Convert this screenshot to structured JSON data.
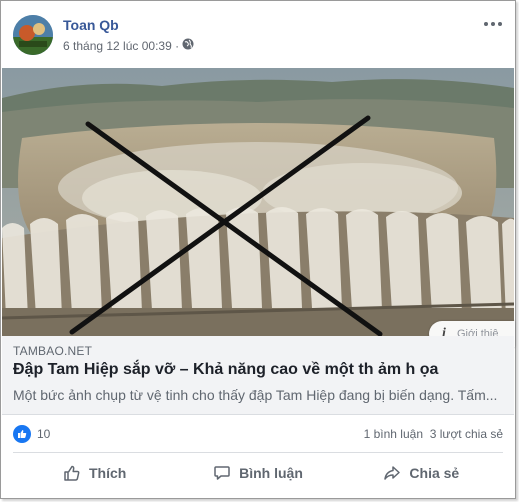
{
  "post": {
    "author": "Toan Qb",
    "timestamp": "6 tháng 12 lúc 00:39 ·",
    "privacy_icon": "globe-icon"
  },
  "image_badge": {
    "icon": "info-icon",
    "label": "Giới thiệ"
  },
  "link": {
    "domain": "TAMBAO.NET",
    "title": "Đập Tam Hiệp sắp vỡ – Khả năng cao về một th ảm h ọa",
    "description": "Một bức ảnh chụp từ vệ tinh cho thấy đập Tam Hiệp đang bị biến dạng. Tấm..."
  },
  "stats": {
    "reaction_icon": "like-icon",
    "likes": "10",
    "comments": "1 bình luận",
    "shares": "3 lượt chia sẻ"
  },
  "actions": {
    "like": "Thích",
    "comment": "Bình luận",
    "share": "Chia sẻ"
  },
  "colors": {
    "author": "#385898",
    "accent": "#1877f2",
    "cross": "#111111"
  }
}
